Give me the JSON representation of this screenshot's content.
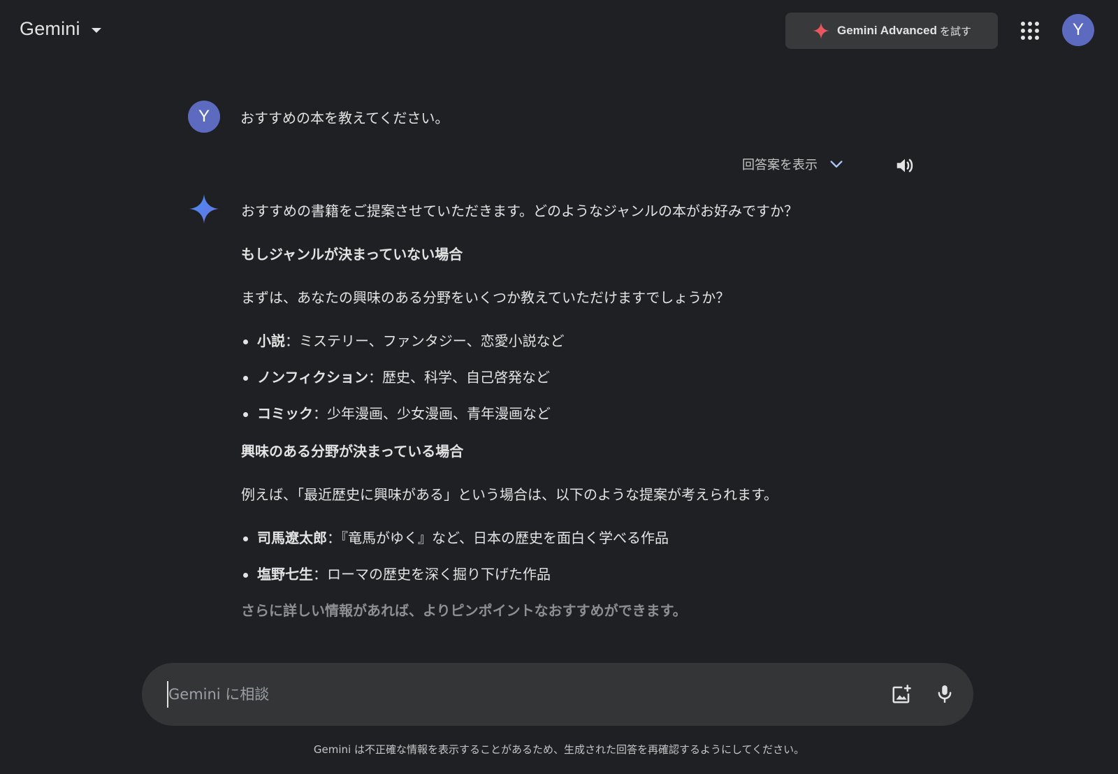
{
  "header": {
    "app_title": "Gemini",
    "advanced_button": {
      "brand": "Gemini Advanced",
      "suffix": "を試す"
    },
    "avatar_initial": "Y"
  },
  "conversation": {
    "user": {
      "avatar_initial": "Y",
      "prompt": "おすすめの本を教えてください。"
    },
    "toolbar": {
      "drafts_label": "回答案を表示"
    },
    "response": {
      "intro": "おすすめの書籍をご提案させていただきます。どのようなジャンルの本がお好みですか？",
      "section1": {
        "heading": "もしジャンルが決まっていない場合",
        "text": "まずは、あなたの興味のある分野をいくつか教えていただけますでしょうか？",
        "items": [
          {
            "term": "小説",
            "desc": "：ミステリー、ファンタジー、恋愛小説など"
          },
          {
            "term": "ノンフィクション",
            "desc": "：歴史、科学、自己啓発など"
          },
          {
            "term": "コミック",
            "desc": "：少年漫画、少女漫画、青年漫画など"
          }
        ]
      },
      "section2": {
        "heading": "興味のある分野が決まっている場合",
        "text": "例えば、「最近歴史に興味がある」という場合は、以下のような提案が考えられます。",
        "items": [
          {
            "term": "司馬遼太郎",
            "desc": "：『竜馬がゆく』など、日本の歴史を面白く学べる作品"
          },
          {
            "term": "塩野七生",
            "desc": "：ローマの歴史を深く掘り下げた作品"
          }
        ]
      },
      "closing": "さらに詳しい情報があれば、よりピンポイントなおすすめができます。"
    }
  },
  "input": {
    "placeholder": "Gemini に相談",
    "value": ""
  },
  "footer": {
    "disclaimer": "Gemini は不正確な情報を表示することがあるため、生成された回答を再確認するようにしてください。"
  },
  "colors": {
    "background": "#1f2023",
    "avatar": "#5c6bc0",
    "input_bg": "#333537",
    "accent_spark": "#e8575f"
  },
  "icons": [
    "caret-down-icon",
    "sparkle-icon",
    "apps-grid-icon",
    "chevron-down-icon",
    "speaker-icon",
    "gemini-spark-icon",
    "add-image-icon",
    "mic-icon"
  ]
}
